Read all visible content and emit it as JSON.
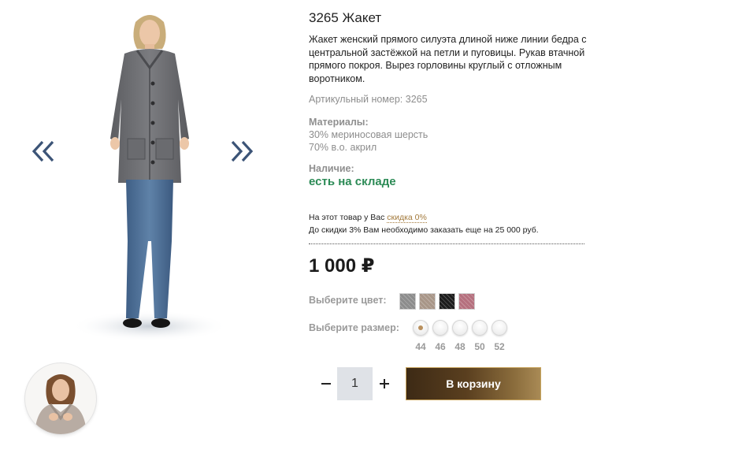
{
  "product": {
    "title": "3265 Жакет",
    "description": "Жакет женский прямого силуэта длиной ниже линии бедра с центральной застёжкой на петли и пуговицы. Рукав втачной прямого покроя. Вырез горловины круглый с отложным воротником.",
    "article": "Артикульный номер: 3265",
    "materials_label": "Материалы:",
    "materials": [
      "30% мериносовая шерсть",
      "70% в.о. акрил"
    ],
    "availability_label": "Наличие:",
    "availability_value": "есть на складе",
    "discount_prefix": "На этот товар у Вас",
    "discount_link": "скидка 0%",
    "discount_next": "До скидки 3% Вам необходимо заказать еще на 25 000 руб.",
    "price": "1 000 ₽",
    "color_label": "Выберите цвет:",
    "colors": [
      {
        "name": "gray",
        "hex": "#8c8c8c"
      },
      {
        "name": "beige",
        "hex": "#a89688"
      },
      {
        "name": "black",
        "hex": "#1c1c1c"
      },
      {
        "name": "pink",
        "hex": "#b5707e"
      }
    ],
    "size_label": "Выберите размер:",
    "sizes": [
      "44",
      "46",
      "48",
      "50",
      "52"
    ],
    "selected_size": "44",
    "quantity": "1",
    "cart_button": "В корзину"
  },
  "gallery": {
    "prev_icon": "double-chevron-left-icon",
    "next_icon": "double-chevron-right-icon",
    "accent_color": "#3c5477"
  }
}
